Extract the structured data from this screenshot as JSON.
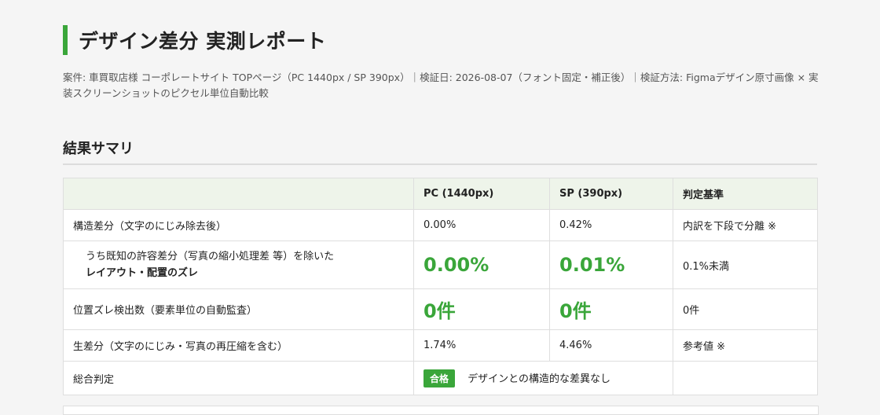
{
  "header": {
    "title": "デザイン差分 実測レポート",
    "meta": "案件: 車買取店様 コーポレートサイト TOPページ（PC 1440px / SP 390px）｜検証日: 2026-08-07（フォント固定・補正後）｜検証方法: Figmaデザイン原寸画像 × 実装スクリーンショットのピクセル単位自動比較"
  },
  "section": {
    "title": "結果サマリ"
  },
  "table": {
    "headers": [
      "",
      "PC (1440px)",
      "SP (390px)",
      "判定基準"
    ],
    "rows": [
      {
        "label": "構造差分（文字のにじみ除去後）",
        "pc": "0.00%",
        "sp": "0.42%",
        "criteria": "内訳を下段で分離 ※"
      },
      {
        "label_line1": "うち既知の許容差分（写真の縮小処理差 等）を除いた",
        "label_line2": "レイアウト・配置のズレ",
        "pc": "0.00%",
        "sp": "0.01%",
        "criteria": "0.1%未満"
      },
      {
        "label": "位置ズレ検出数（要素単位の自動監査）",
        "pc": "0件",
        "sp": "0件",
        "criteria": "0件"
      },
      {
        "label": "生差分（文字のにじみ・写真の再圧縮を含む）",
        "pc": "1.74%",
        "sp": "4.46%",
        "criteria": "参考値 ※"
      },
      {
        "label": "総合判定",
        "badge": "合格",
        "verdict": "デザインとの構造的な差異なし",
        "criteria": ""
      }
    ]
  },
  "colors": {
    "accent": "#3aa63a",
    "header_bg": "#eef4ea"
  }
}
